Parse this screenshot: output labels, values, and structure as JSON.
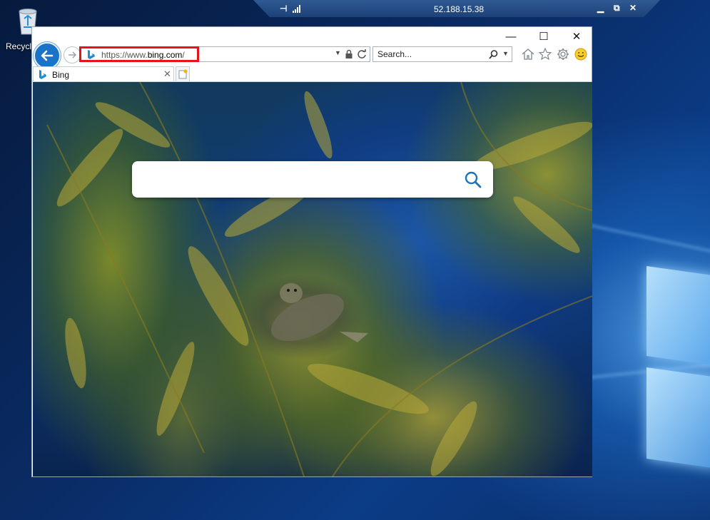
{
  "desktop": {
    "recycle_bin_label": "Recycle"
  },
  "rdp_bar": {
    "title": "52.188.15.38",
    "pin_icon": "pin-icon",
    "signal_icon": "signal-bars-icon",
    "controls": [
      "minimize",
      "restore",
      "close"
    ]
  },
  "browser": {
    "address": {
      "prefix": "https://www.",
      "domain": "bing.com",
      "suffix": "/",
      "highlight_color": "#e8121c"
    },
    "search": {
      "placeholder": "Search..."
    },
    "toolbar_icons": [
      "home-icon",
      "star-icon",
      "gear-icon",
      "smiley-icon"
    ],
    "tabs": [
      {
        "title": "Bing",
        "active": true
      }
    ],
    "accent_color": "#1a73c6"
  },
  "page": {
    "search_input_value": "",
    "background": "underwater kelp forest with sea lion"
  }
}
